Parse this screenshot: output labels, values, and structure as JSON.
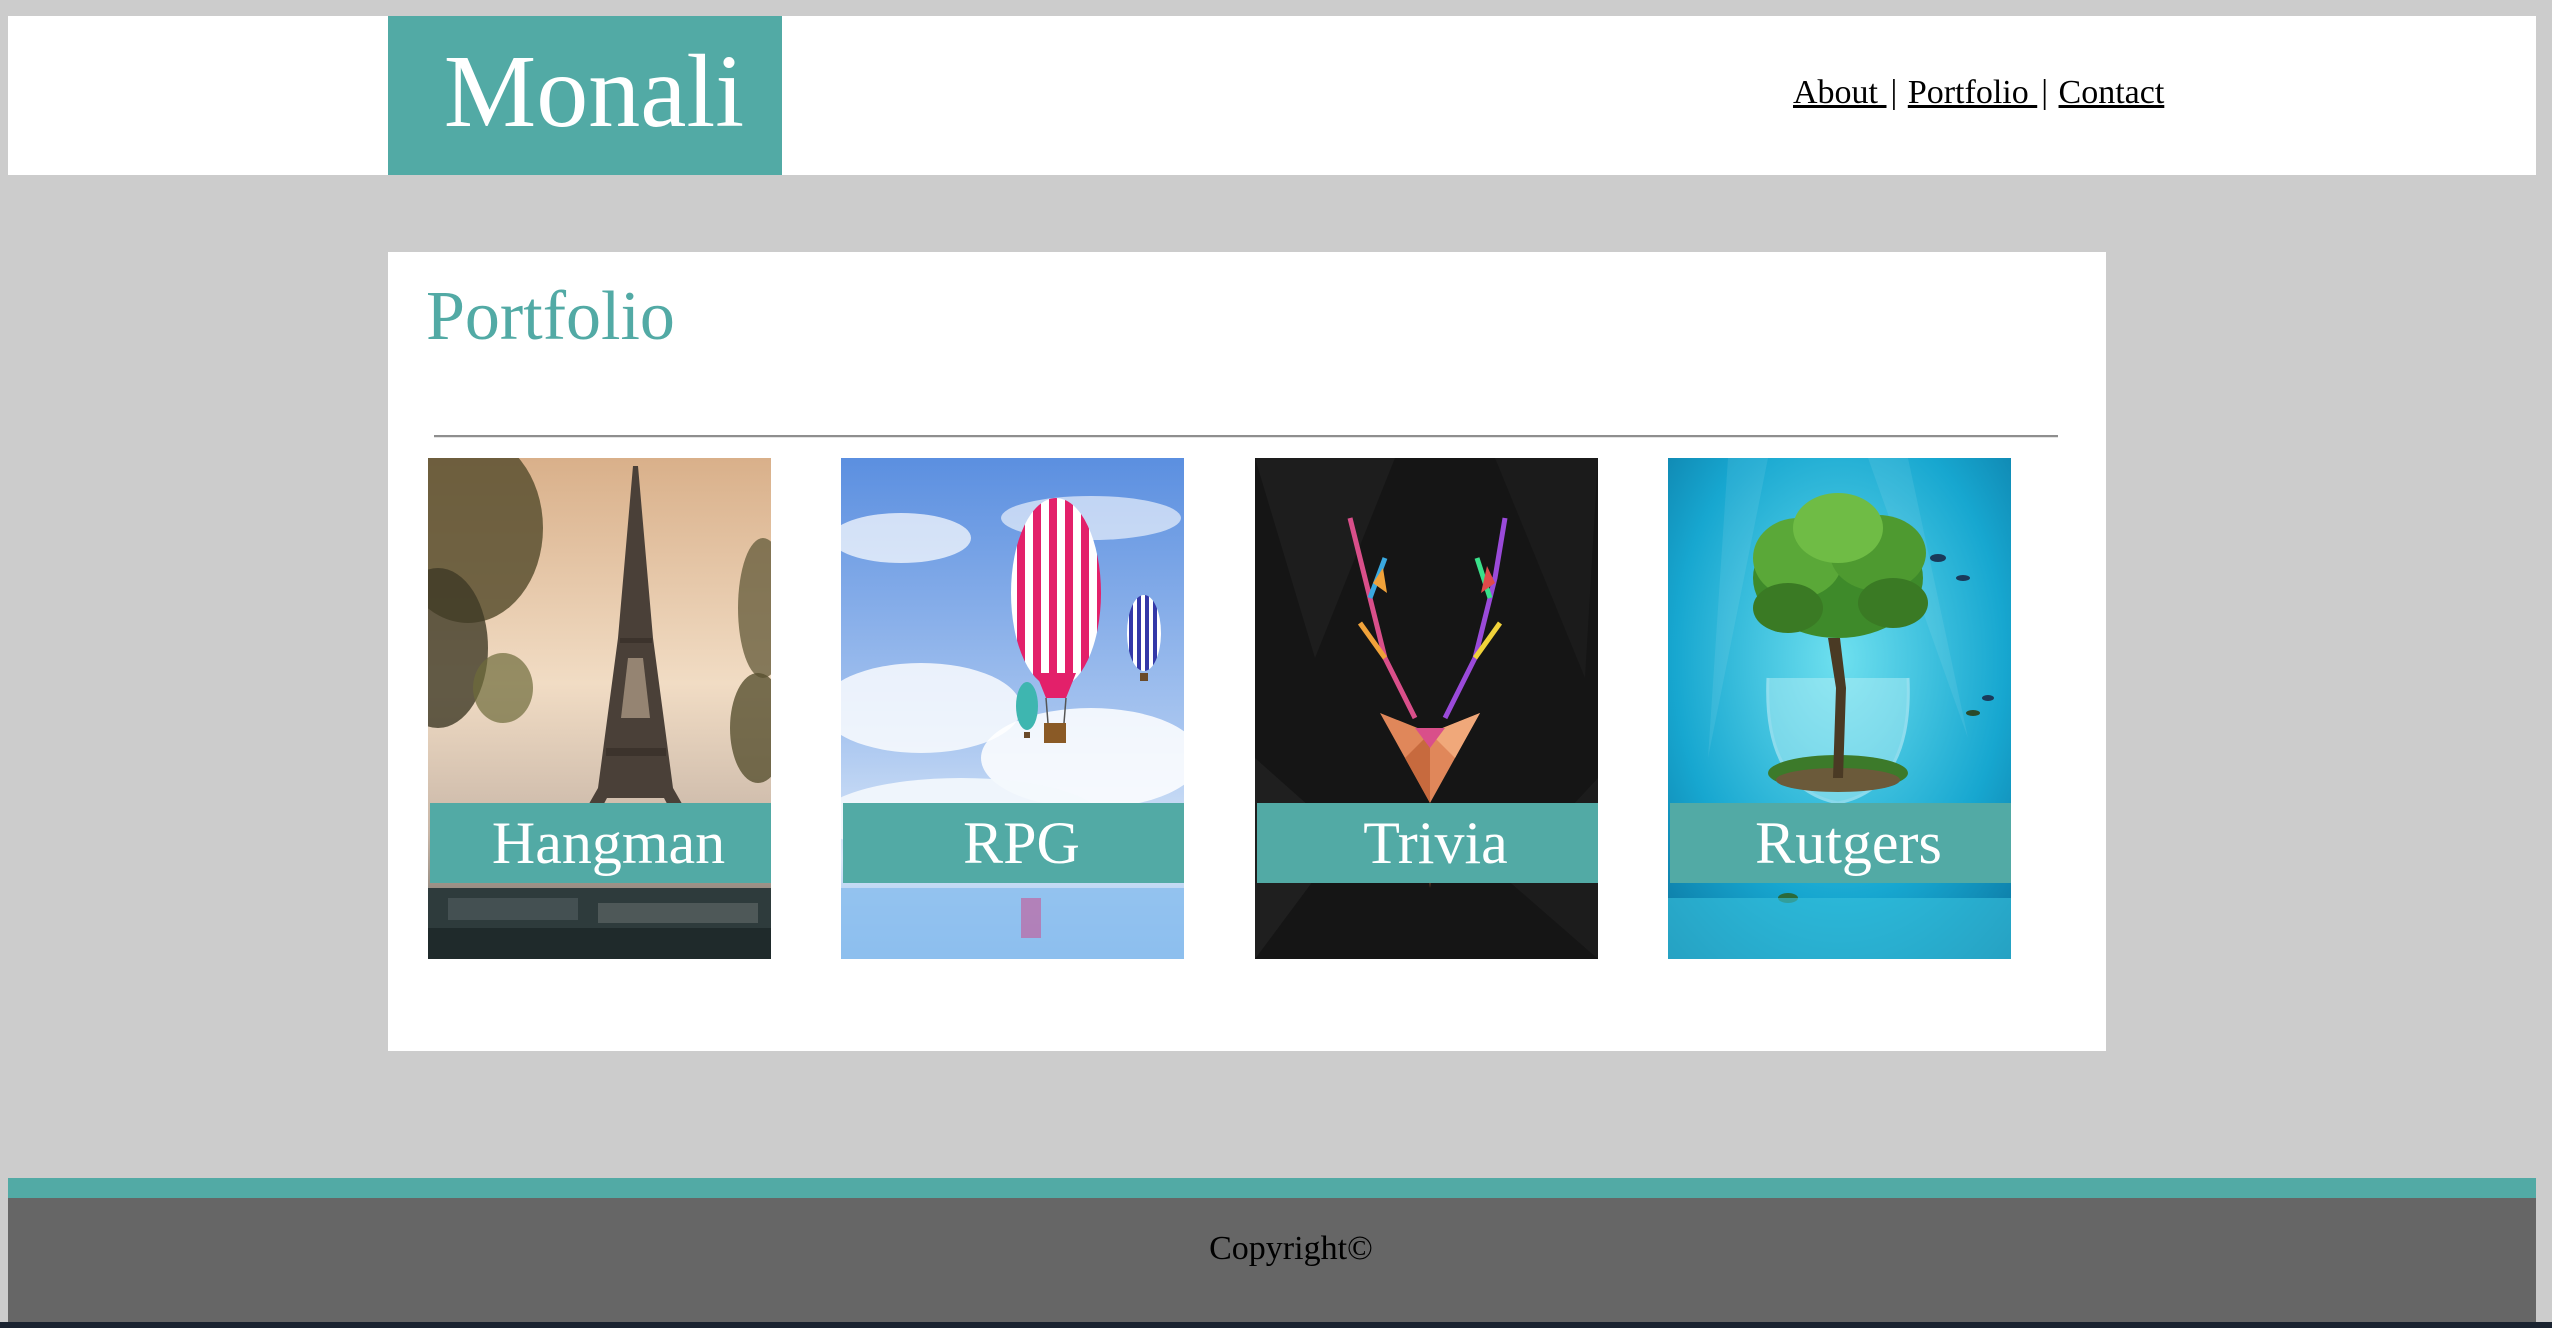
{
  "header": {
    "logo_text": "Monali",
    "nav": [
      {
        "label": "About "
      },
      {
        "label": "Portfolio "
      },
      {
        "label": "Contact"
      }
    ],
    "nav_separator": "|"
  },
  "main": {
    "title": "Portfolio",
    "projects": [
      {
        "label": "Hangman",
        "image": "eiffel-tower-image"
      },
      {
        "label": "RPG",
        "image": "hot-air-balloons-image"
      },
      {
        "label": "Trivia",
        "image": "geometric-deer-image"
      },
      {
        "label": "Rutgers",
        "image": "tree-in-glass-underwater-image"
      }
    ]
  },
  "footer": {
    "copyright": "Copyright©"
  },
  "colors": {
    "accent": "#52aaa5",
    "page_background": "#cccccc",
    "footer_background": "#666666",
    "panel_background": "#ffffff"
  }
}
